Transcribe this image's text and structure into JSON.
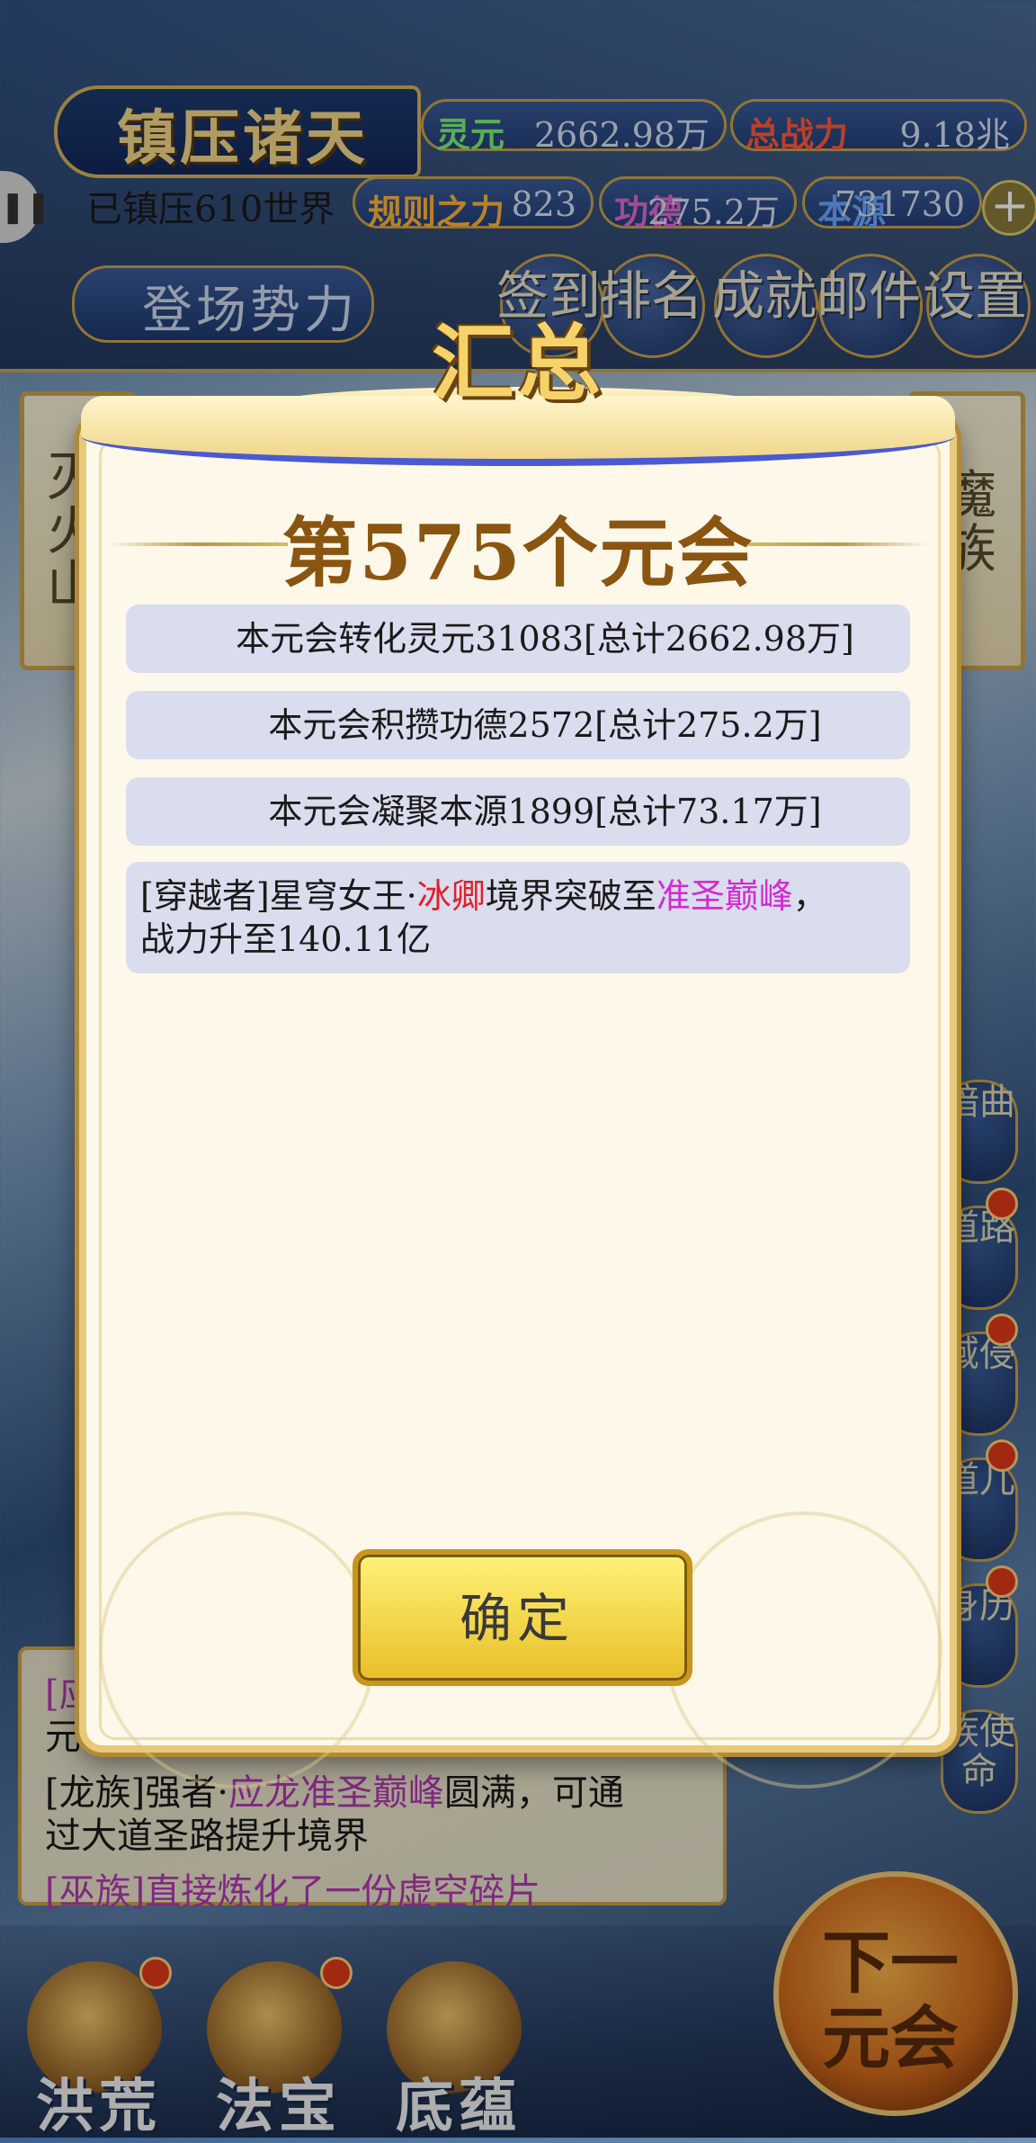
{
  "hud": {
    "world_title": "镇压诸天",
    "suppressed": "已镇压610世界",
    "lingyuan_label": "灵元",
    "lingyuan_value": "2662.98万",
    "power_label": "总战力",
    "power_value": "9.18兆",
    "rule_label": "规则之力",
    "rule_value": "823",
    "merit_label": "功德",
    "merit_value": "275.2万",
    "source_label": "本源",
    "source_value": "731730",
    "faction_button": "登场势力",
    "menu": [
      "签到",
      "排名",
      "成就",
      "邮件",
      "设置"
    ]
  },
  "background": {
    "left_card": "灭火山",
    "right_card": "魔族",
    "right_tabs": [
      "暗曲",
      "道路",
      "域侵",
      "道儿",
      "身历",
      "族使命"
    ],
    "log_partial": "[应",
    "log_partial2": "元",
    "log_line1_prefix": "[龙族]强者·",
    "log_line1_name": "应龙准圣巅峰",
    "log_line1_suffix": "圆满，可通",
    "log_line2": "过大道圣路提升境界",
    "log_line3": "[巫族]直接炼化了一份虚空碎片"
  },
  "nav": {
    "items": [
      "洪荒",
      "法宝",
      "底蕴"
    ],
    "next_button": "下一元会"
  },
  "dialog": {
    "title": "汇总",
    "era_title": "第575个元会",
    "rows": [
      "本元会转化灵元31083[总计2662.98万]",
      "本元会积攒功德2572[总计275.2万]",
      "本元会凝聚本源1899[总计73.17万]"
    ],
    "event": {
      "prefix": "[穿越者]星穹女王·",
      "name": "冰卿",
      "mid": "境界突破至",
      "realm": "准圣巅峰",
      "suffix": "，",
      "line2": "战力升至140.11亿"
    },
    "confirm_label": "确定"
  }
}
